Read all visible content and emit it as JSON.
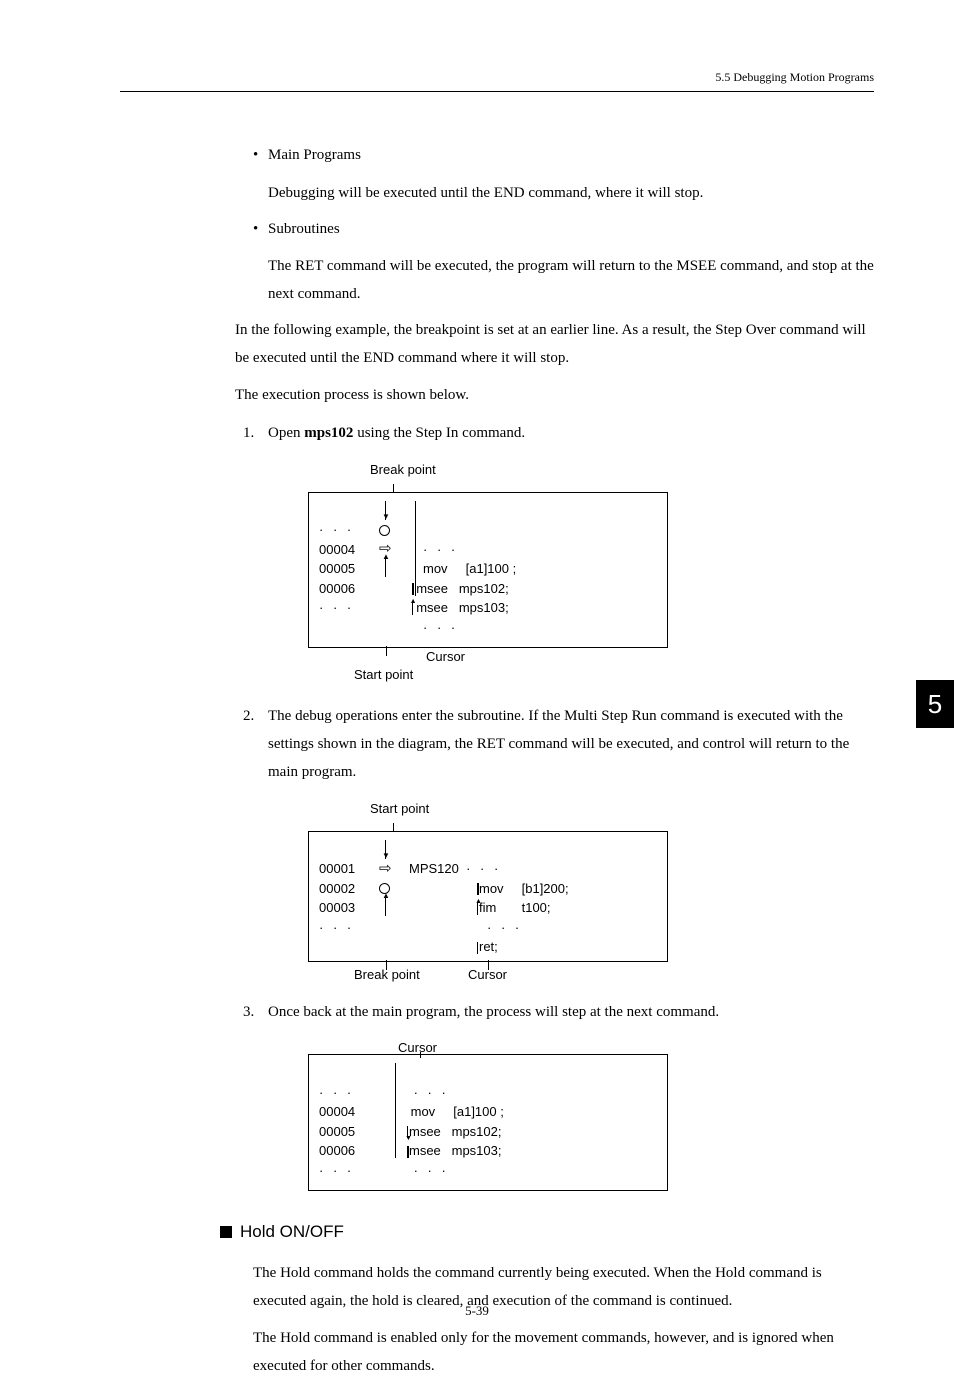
{
  "header": {
    "section": "5.5  Debugging Motion Programs"
  },
  "bullets": {
    "main_programs": "Main Programs",
    "main_programs_text": "Debugging will be executed until the END command, where it will stop.",
    "subroutines": "Subroutines",
    "subroutines_text": "The RET command will be executed, the program will return to the MSEE command, and stop at the next command."
  },
  "paras": {
    "example_intro": "In the following example, the breakpoint is set at an earlier line. As a result, the Step Over command will be executed until the END command where it will stop.",
    "exec_shown": "The execution process is shown below."
  },
  "steps": {
    "s1_pre": "Open ",
    "s1_bold": "mps102",
    "s1_post": " using the Step In command.",
    "s2": "The debug operations enter the subroutine. If the Multi Step Run command is executed with the settings shown in the diagram, the RET command will be executed, and control will return to the main program.",
    "s3": "Once back at the main program, the process will step at the next command."
  },
  "diag1": {
    "break_point": "Break point",
    "start_point": "Start point",
    "cursor": "Cursor",
    "nums": [
      "00004",
      "00005",
      "00006"
    ],
    "code": [
      "mov     [a1]100 ;",
      "msee   mps102;",
      "msee   mps103;"
    ]
  },
  "diag2": {
    "start_point": "Start point",
    "break_point": "Break point",
    "cursor": "Cursor",
    "nums": [
      "00001",
      "00002",
      "00003"
    ],
    "heading": "MPS120",
    "code": [
      "mov     [b1]200;",
      "fim       t100;"
    ],
    "ret": "ret;"
  },
  "diag3": {
    "cursor": "Cursor",
    "nums": [
      "00004",
      "00005",
      "00006"
    ],
    "code": [
      "mov     [a1]100 ;",
      "msee   mps102;",
      "msee   mps103;"
    ]
  },
  "hold": {
    "title": "Hold ON/OFF",
    "p1": "The Hold command holds the command currently being executed. When the Hold command is executed again, the hold is cleared, and execution of the command is continued.",
    "p2": "The Hold command is enabled only for the movement commands, however, and is ignored when executed for other commands."
  },
  "tab": "5",
  "footer": "5-39"
}
